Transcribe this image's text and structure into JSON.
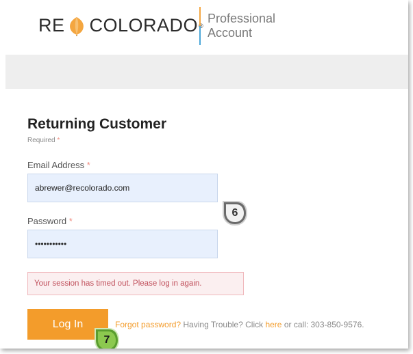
{
  "brand": {
    "logo_left": "RE",
    "logo_right": "COLORADO",
    "logo_reg": "®",
    "tagline_line1": "Professional",
    "tagline_line2": "Account"
  },
  "form": {
    "title": "Returning Customer",
    "required_label": "Required",
    "required_star": "*",
    "email_label": "Email Address",
    "email_value": "abrewer@recolorado.com",
    "password_label": "Password",
    "password_value": "•••••••••••",
    "error_message": "Your session has timed out. Please log in again.",
    "login_button": "Log In",
    "forgot_link": "Forgot password?",
    "trouble_text": "Having Trouble? Click",
    "here_link": "here",
    "call_text": "or call: 303-850-9576."
  },
  "callouts": {
    "six": "6",
    "seven": "7"
  },
  "colors": {
    "accent_orange": "#f39c2b",
    "accent_blue": "#4aa6d8",
    "input_bg": "#e8f0fd",
    "error_bg": "#fbeff0",
    "error_text": "#c0505c",
    "callout_gray": "#6b6b6b",
    "callout_green": "#7ac142"
  }
}
